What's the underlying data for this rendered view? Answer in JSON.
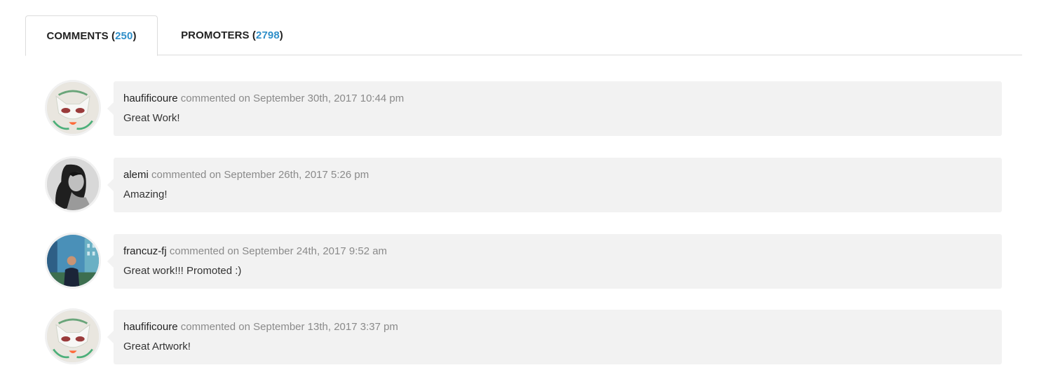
{
  "tabs": [
    {
      "label_prefix": "COMMENTS (",
      "count": "250",
      "label_suffix": ")",
      "active": true
    },
    {
      "label_prefix": "PROMOTERS (",
      "count": "2798",
      "label_suffix": ")",
      "active": false
    }
  ],
  "comments": [
    {
      "user": "haufificoure",
      "meta": "commented on September 30th, 2017 10:44 pm",
      "text": "Great Work!",
      "avatar_icon": "cat-mask-avatar"
    },
    {
      "user": "alemi",
      "meta": "commented on September 26th, 2017 5:26 pm",
      "text": "Amazing!",
      "avatar_icon": "portrait-avatar"
    },
    {
      "user": "francuz-fj",
      "meta": "commented on September 24th, 2017 9:52 am",
      "text": "Great work!!! Promoted :)",
      "avatar_icon": "person-city-avatar"
    },
    {
      "user": "haufificoure",
      "meta": "commented on September 13th, 2017 3:37 pm",
      "text": "Great Artwork!",
      "avatar_icon": "cat-mask-avatar"
    }
  ],
  "colors": {
    "accent": "#2f8fc9",
    "bubble": "#f2f2f2",
    "divider": "#dcdcdc"
  }
}
